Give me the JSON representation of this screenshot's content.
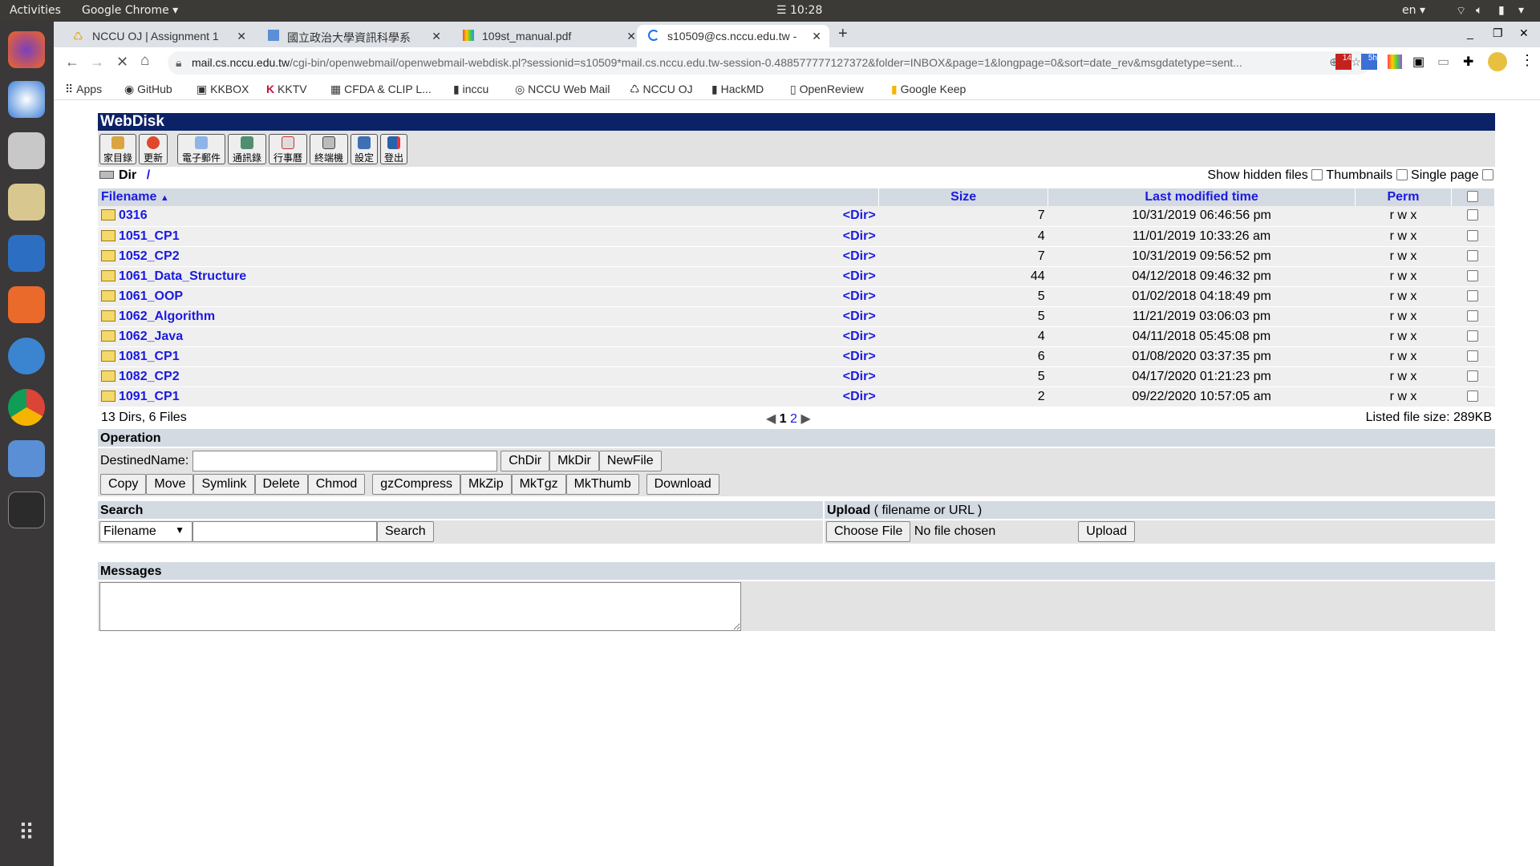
{
  "system": {
    "activities": "Activities",
    "app": "Google Chrome",
    "clock": "10:28",
    "lang": "en"
  },
  "tabs": [
    {
      "label": "NCCU OJ | Assignment 1"
    },
    {
      "label": "國立政治大學資訊科學系"
    },
    {
      "label": "109st_manual.pdf"
    },
    {
      "label": "s10509@cs.nccu.edu.tw -",
      "active": true
    }
  ],
  "address": {
    "host": "mail.cs.nccu.edu.tw",
    "path": "/cgi-bin/openwebmail/openwebmail-webdisk.pl?sessionid=s10509*mail.cs.nccu.edu.tw-session-0.488577777127372&folder=INBOX&page=1&longpage=0&sort=date_rev&msgdatetype=sent..."
  },
  "extensions": {
    "gmail_badge": "14",
    "ext_badge": "5h"
  },
  "bookmarks": [
    "Apps",
    "GitHub",
    "KKBOX",
    "KKTV",
    "CFDA & CLIP L...",
    "inccu",
    "NCCU Web Mail",
    "NCCU OJ",
    "HackMD",
    "OpenReview",
    "Google Keep"
  ],
  "webdisk": {
    "title": "WebDisk",
    "toolbar": [
      "家目錄",
      "更新",
      "電子郵件",
      "通訊錄",
      "行事曆",
      "終端機",
      "設定",
      "登出"
    ],
    "dir_label": "Dir",
    "dir_path": "/",
    "options": {
      "hidden": "Show hidden files",
      "thumbs": "Thumbnails",
      "single": "Single page"
    },
    "columns": {
      "filename": "Filename",
      "size": "Size",
      "modified": "Last modified time",
      "perm": "Perm"
    },
    "rows": [
      {
        "name": "0316",
        "type": "<Dir>",
        "size": "7",
        "time": "10/31/2019 06:46:56 pm",
        "perm": "r w x"
      },
      {
        "name": "1051_CP1",
        "type": "<Dir>",
        "size": "4",
        "time": "11/01/2019 10:33:26 am",
        "perm": "r w x"
      },
      {
        "name": "1052_CP2",
        "type": "<Dir>",
        "size": "7",
        "time": "10/31/2019 09:56:52 pm",
        "perm": "r w x"
      },
      {
        "name": "1061_Data_Structure",
        "type": "<Dir>",
        "size": "44",
        "time": "04/12/2018 09:46:32 pm",
        "perm": "r w x"
      },
      {
        "name": "1061_OOP",
        "type": "<Dir>",
        "size": "5",
        "time": "01/02/2018 04:18:49 pm",
        "perm": "r w x"
      },
      {
        "name": "1062_Algorithm",
        "type": "<Dir>",
        "size": "5",
        "time": "11/21/2019 03:06:03 pm",
        "perm": "r w x"
      },
      {
        "name": "1062_Java",
        "type": "<Dir>",
        "size": "4",
        "time": "04/11/2018 05:45:08 pm",
        "perm": "r w x"
      },
      {
        "name": "1081_CP1",
        "type": "<Dir>",
        "size": "6",
        "time": "01/08/2020 03:37:35 pm",
        "perm": "r w x"
      },
      {
        "name": "1082_CP2",
        "type": "<Dir>",
        "size": "5",
        "time": "04/17/2020 01:21:23 pm",
        "perm": "r w x"
      },
      {
        "name": "1091_CP1",
        "type": "<Dir>",
        "size": "2",
        "time": "09/22/2020 10:57:05 am",
        "perm": "r w x"
      }
    ],
    "summary": "13 Dirs, 6 Files",
    "page_current": "1",
    "page_next": "2",
    "listed_size": "Listed file size: 289KB",
    "operation": {
      "title": "Operation",
      "dest_label": "DestinedName:",
      "dest_value": "",
      "buttons1": [
        "ChDir",
        "MkDir",
        "NewFile"
      ],
      "buttons2": [
        "Copy",
        "Move",
        "Symlink",
        "Delete",
        "Chmod"
      ],
      "buttons3": [
        "gzCompress",
        "MkZip",
        "MkTgz",
        "MkThumb"
      ],
      "download": "Download"
    },
    "search": {
      "title": "Search",
      "select": "Filename",
      "value": "",
      "button": "Search"
    },
    "upload": {
      "title": "Upload",
      "hint": "( filename or URL )",
      "choose": "Choose File",
      "status": "No file chosen",
      "button": "Upload"
    },
    "messages": {
      "title": "Messages",
      "value": ""
    }
  }
}
